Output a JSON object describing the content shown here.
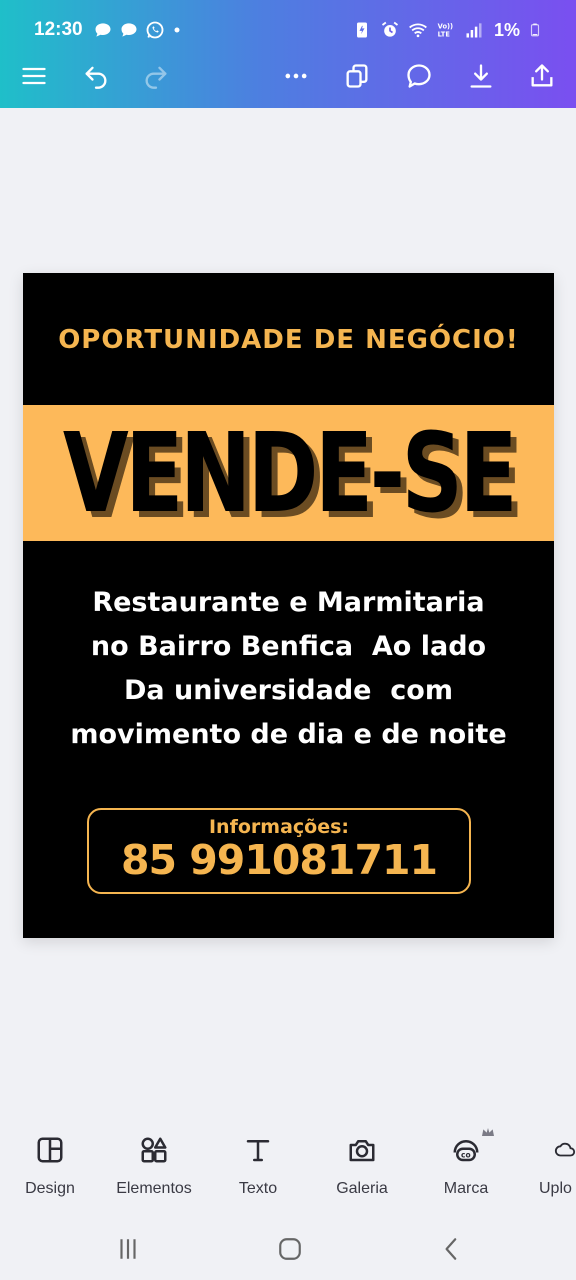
{
  "status_bar": {
    "time": "12:30",
    "battery": "1%",
    "notification_icons": [
      "chat-bubble-icon",
      "chat-bubble-icon",
      "whatsapp-icon",
      "dot-icon"
    ],
    "system_icons": [
      "battery-saver-icon",
      "alarm-icon",
      "wifi-icon",
      "volte-icon",
      "signal-icon",
      "battery-icon"
    ]
  },
  "toolbar": {
    "icons": [
      "menu-icon",
      "undo-icon",
      "redo-icon",
      "more-icon",
      "copy-icon",
      "comment-icon",
      "download-icon",
      "share-icon"
    ]
  },
  "poster": {
    "kicker": "OPORTUNIDADE DE NEGÓCIO!",
    "headline": "VENDE-SE",
    "body_lines": [
      "Restaurante e Marmitaria",
      "no Bairro Benfica  Ao lado",
      "Da universidade  com",
      "movimento de dia e de noite"
    ],
    "info_label": "Informações:",
    "info_phone": "85  991081711",
    "colors": {
      "background": "#000000",
      "accent": "#fdb95a",
      "text": "#ffffff"
    }
  },
  "bottom_tools": [
    {
      "label": "Design",
      "icon": "design-icon"
    },
    {
      "label": "Elementos",
      "icon": "elements-icon"
    },
    {
      "label": "Texto",
      "icon": "text-icon"
    },
    {
      "label": "Galeria",
      "icon": "camera-icon"
    },
    {
      "label": "Marca",
      "icon": "brand-icon"
    },
    {
      "label": "Uplo",
      "icon": "upload-cloud-icon"
    }
  ],
  "nav_bar": {
    "icons": [
      "recents-icon",
      "home-icon",
      "back-icon"
    ]
  }
}
